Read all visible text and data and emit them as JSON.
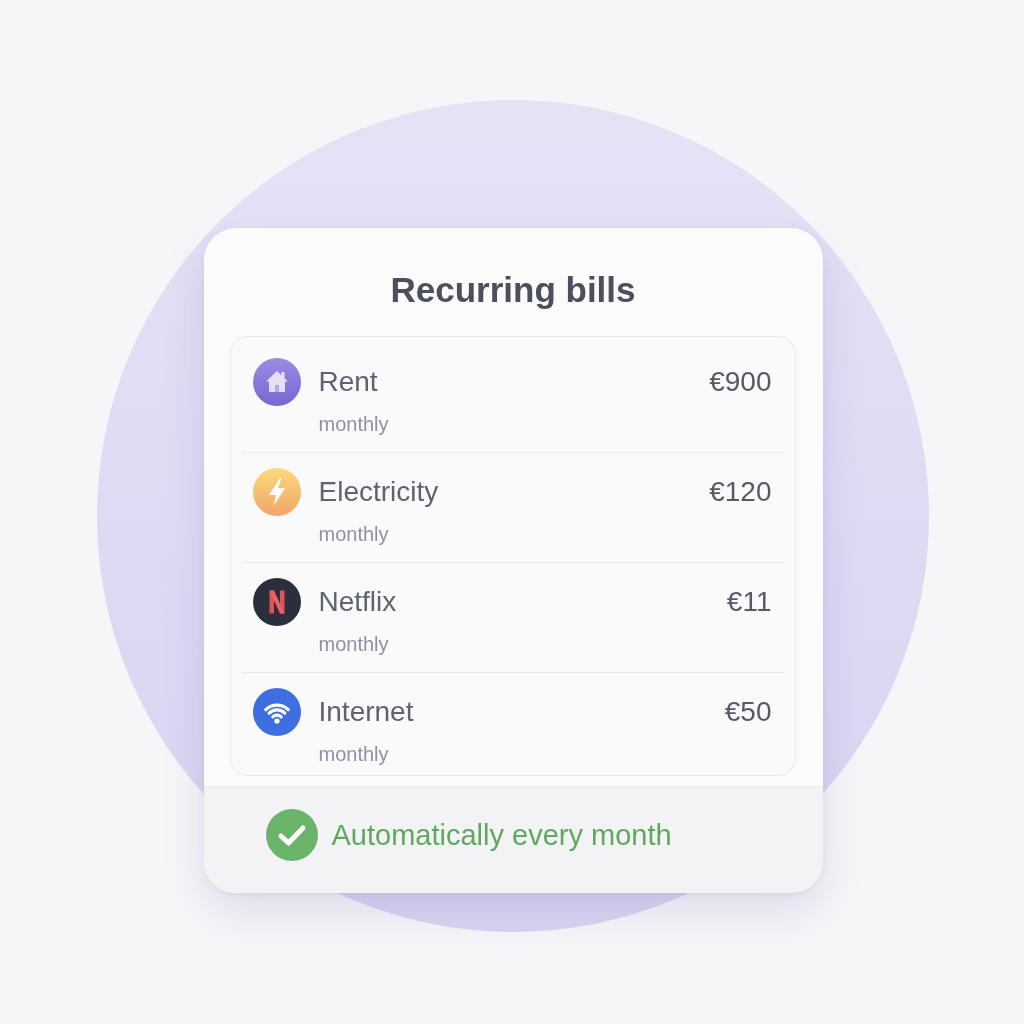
{
  "title": "Recurring bills",
  "bills": [
    {
      "kind": "home",
      "name": "Rent",
      "frequency": "monthly",
      "amount": "€900"
    },
    {
      "kind": "power",
      "name": "Electricity",
      "frequency": "monthly",
      "amount": "€120"
    },
    {
      "kind": "streaming",
      "name": "Netflix",
      "frequency": "monthly",
      "amount": "€11"
    },
    {
      "kind": "wifi",
      "name": "Internet",
      "frequency": "monthly",
      "amount": "€50"
    }
  ],
  "footer": {
    "text": "Automatically every month"
  }
}
